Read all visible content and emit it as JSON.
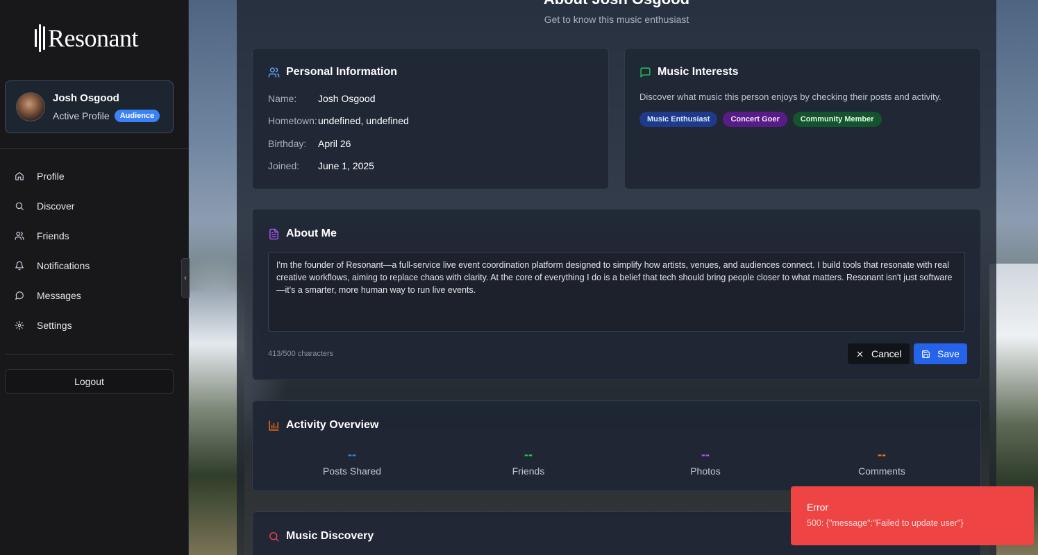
{
  "app": {
    "name": "Resonant"
  },
  "sidebar": {
    "profile": {
      "name": "Josh Osgood",
      "status": "Active Profile",
      "badge": "Audience"
    },
    "nav": [
      {
        "label": "Profile",
        "icon": "home-icon"
      },
      {
        "label": "Discover",
        "icon": "search-icon"
      },
      {
        "label": "Friends",
        "icon": "users-icon"
      },
      {
        "label": "Notifications",
        "icon": "bell-icon"
      },
      {
        "label": "Messages",
        "icon": "message-icon"
      },
      {
        "label": "Settings",
        "icon": "gear-icon"
      }
    ],
    "logout_label": "Logout"
  },
  "page": {
    "title": "About Josh Osgood",
    "subtitle": "Get to know this music enthusiast"
  },
  "personal_info": {
    "title": "Personal Information",
    "rows": [
      {
        "label": "Name:",
        "value": "Josh Osgood"
      },
      {
        "label": "Hometown:",
        "value": "undefined, undefined"
      },
      {
        "label": "Birthday:",
        "value": "April 26"
      },
      {
        "label": "Joined:",
        "value": "June 1, 2025"
      }
    ]
  },
  "music_interests": {
    "title": "Music Interests",
    "description": "Discover what music this person enjoys by checking their posts and activity.",
    "tags": [
      {
        "label": "Music Enthusiast",
        "bg": "#1e3a8a",
        "fg": "#dbeafe"
      },
      {
        "label": "Concert Goer",
        "bg": "#581c87",
        "fg": "#f3e8ff"
      },
      {
        "label": "Community Member",
        "bg": "#14532d",
        "fg": "#dcfce7"
      }
    ]
  },
  "about_me": {
    "title": "About Me",
    "text": "I'm the founder of Resonant—a full-service live event coordination platform designed to simplify how artists, venues, and audiences connect. I build tools that resonate with real creative workflows, aiming to replace chaos with clarity. At the core of everything I do is a belief that tech should bring people closer to what matters. Resonant isn't just software—it's a smarter, more human way to run live events.",
    "char_count": "413/500 characters",
    "cancel_label": "Cancel",
    "save_label": "Save"
  },
  "activity": {
    "title": "Activity Overview",
    "stats": [
      {
        "value": "--",
        "label": "Posts Shared",
        "color": "#3b82f6"
      },
      {
        "value": "--",
        "label": "Friends",
        "color": "#22c55e"
      },
      {
        "value": "--",
        "label": "Photos",
        "color": "#a855f7"
      },
      {
        "value": "--",
        "label": "Comments",
        "color": "#f97316"
      }
    ]
  },
  "discovery": {
    "title": "Music Discovery"
  },
  "toast": {
    "title": "Error",
    "message": "500: {\"message\":\"Failed to update user\"}"
  },
  "colors": {
    "accent": "#3b82f6",
    "error": "#ef4444",
    "save": "#2563eb"
  }
}
